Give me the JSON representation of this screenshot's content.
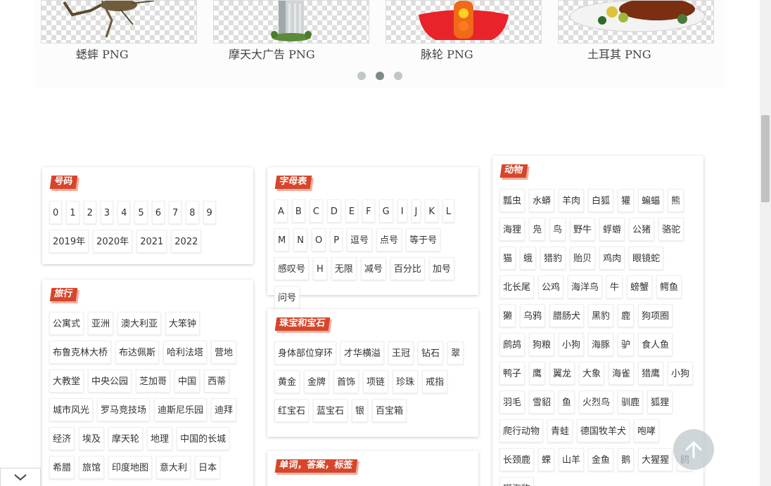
{
  "carousel": {
    "slides": [
      {
        "caption": "蟋蟀 PNG"
      },
      {
        "caption": "摩天大广告 PNG"
      },
      {
        "caption": "脉轮 PNG"
      },
      {
        "caption": "土耳其 PNG"
      }
    ],
    "dots": 3,
    "active_dot": 1
  },
  "cards": {
    "numbers": {
      "title": "号码",
      "tags": [
        "0",
        "1",
        "2",
        "3",
        "4",
        "5",
        "6",
        "7",
        "8",
        "9",
        "2019年",
        "2020年",
        "2021",
        "2022"
      ]
    },
    "alphabet": {
      "title": "字母表",
      "tags": [
        "A",
        "B",
        "C",
        "D",
        "E",
        "F",
        "G",
        "I",
        "J",
        "K",
        "L",
        "M",
        "N",
        "O",
        "P",
        "逗号",
        "点号",
        "等于号",
        "感叹号",
        "H",
        "无限",
        "减号",
        "百分比",
        "加号",
        "问号"
      ]
    },
    "travel": {
      "title": "旅行",
      "tags": [
        "公寓式",
        "亚洲",
        "澳大利亚",
        "大笨钟",
        "布鲁克林大桥",
        "布达佩斯",
        "哈利法塔",
        "营地",
        "大教堂",
        "中央公园",
        "芝加哥",
        "中国",
        "西蒂",
        "城市风光",
        "罗马竞技场",
        "迪斯尼乐园",
        "迪拜",
        "经济",
        "埃及",
        "摩天轮",
        "地理",
        "中国的长城",
        "希腊",
        "旅馆",
        "印度地图",
        "意大利",
        "日本"
      ]
    },
    "jewelry": {
      "title": "珠宝和宝石",
      "tags": [
        "身体部位穿环",
        "才华横溢",
        "王冠",
        "钻石",
        "翠",
        "黄金",
        "金牌",
        "首饰",
        "项链",
        "珍珠",
        "戒指",
        "红宝石",
        "蓝宝石",
        "银",
        "百宝箱"
      ]
    },
    "words": {
      "title": "单词，答案，标签"
    },
    "animals": {
      "title": "动物",
      "tags": [
        "瓢虫",
        "水蟒",
        "羊肉",
        "白狐",
        "獾",
        "蝙蝠",
        "熊",
        "海狸",
        "凫",
        "鸟",
        "野牛",
        "蜉蝣",
        "公猪",
        "骆驼",
        "猫",
        "蛾",
        "猎豹",
        "贻贝",
        "鸡肉",
        "眼镜蛇",
        "北长尾",
        "公鸡",
        "海洋鸟",
        "牛",
        "螃蟹",
        "鳄鱼",
        "獭",
        "乌鸦",
        "腊肠犬",
        "黑豹",
        "鹿",
        "狗项圈",
        "鹧鸪",
        "狗粮",
        "小狗",
        "海豚",
        "驴",
        "食人鱼",
        "鸭子",
        "鹰",
        "翼龙",
        "大象",
        "海雀",
        "猎鹰",
        "小狗",
        "羽毛",
        "雪貂",
        "鱼",
        "火烈鸟",
        "驯鹿",
        "狐狸",
        "爬行动物",
        "青蛙",
        "德国牧羊犬",
        "咆哮",
        "长颈鹿",
        "蝾",
        "山羊",
        "金鱼",
        "鹅",
        "大猩猩",
        "鸥",
        "斑海豹"
      ]
    }
  },
  "colors": {
    "title_bg": "#d6462b",
    "title_shadow": "#f0b0a2",
    "dot": "#bfc7c7",
    "dot_active": "#7e8b8b"
  },
  "icons": {
    "back_top": "arrow-up-icon",
    "collapse": "chevron-down-icon"
  }
}
